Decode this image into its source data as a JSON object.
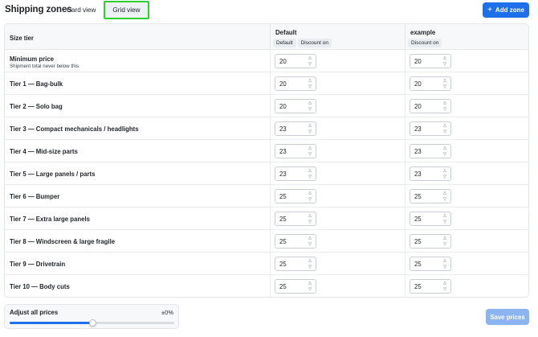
{
  "header": {
    "title": "Shipping zones",
    "view_tabs": [
      {
        "label": "Card view",
        "active": false
      },
      {
        "label": "Grid view",
        "active": true
      }
    ],
    "add_zone_label": "Add zone",
    "add_zone_icon": "plus-icon"
  },
  "grid": {
    "size_tier_header": "Size tier",
    "zones": [
      {
        "name": "Default",
        "chips": [
          "Default",
          "Discount on"
        ]
      },
      {
        "name": "example",
        "chips": [
          "Discount on"
        ]
      }
    ],
    "rows": [
      {
        "label": "Minimum price",
        "sublabel": "Shipment total never below this",
        "values": [
          "20",
          "20"
        ]
      },
      {
        "label": "Tier 1 — Bag-bulk",
        "values": [
          "20",
          "20"
        ]
      },
      {
        "label": "Tier 2 — Solo bag",
        "values": [
          "20",
          "20"
        ]
      },
      {
        "label": "Tier 3 — Compact mechanicals / headlights",
        "values": [
          "23",
          "23"
        ]
      },
      {
        "label": "Tier 4 — Mid-size parts",
        "values": [
          "23",
          "23"
        ]
      },
      {
        "label": "Tier 5 — Large panels / parts",
        "values": [
          "23",
          "23"
        ]
      },
      {
        "label": "Tier 6 — Bumper",
        "values": [
          "25",
          "25"
        ]
      },
      {
        "label": "Tier 7 — Extra large panels",
        "values": [
          "25",
          "25"
        ]
      },
      {
        "label": "Tier 8 — Windscreen & large fragile",
        "values": [
          "25",
          "25"
        ]
      },
      {
        "label": "Tier 9 — Drivetrain",
        "values": [
          "25",
          "25"
        ]
      },
      {
        "label": "Tier 10 — Body cuts",
        "values": [
          "25",
          "25"
        ]
      }
    ]
  },
  "adjust": {
    "label": "Adjust all prices",
    "value_text": "±0%",
    "slider_fraction": 0.5
  },
  "save_label": "Save prices",
  "stepper_icons": {
    "up": "chevron-up-icon",
    "down": "chevron-down-icon"
  },
  "colors": {
    "accent": "#1f6feb",
    "highlight": "#2fcf2f",
    "save_disabled": "#8cb4f0"
  }
}
